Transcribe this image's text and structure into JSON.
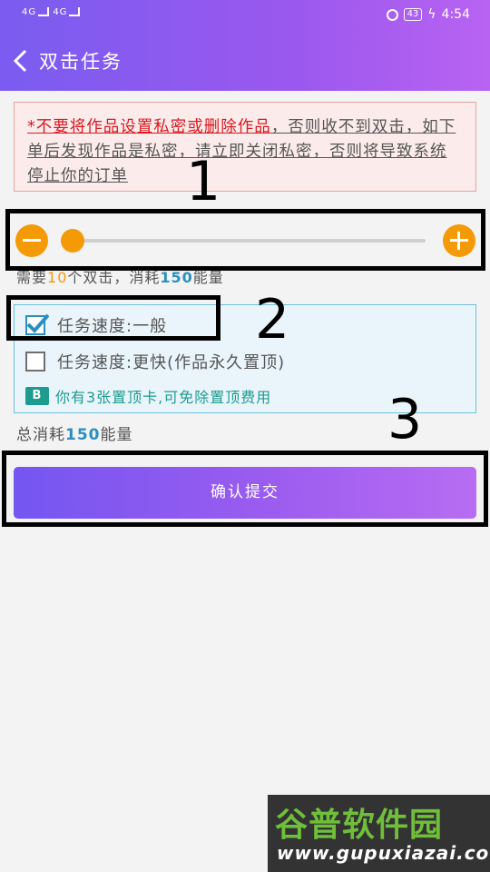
{
  "status_bar": {
    "network_left": "4G",
    "network_right": "4G",
    "battery": "43",
    "time": "4:54"
  },
  "header": {
    "title": "双击任务"
  },
  "notice": {
    "asterisk_text": "*不要将作品设置私密或删除作品",
    "rest_text": "，否则收不到双击，如下单后发现作品是私密，请立即关闭私密，否则将导致系统停止你的订单"
  },
  "slider": {
    "value_fraction": 0.01
  },
  "need": {
    "prefix": "需要",
    "count": "10",
    "middle": "个双击，消耗",
    "energy": "150",
    "suffix": "能量"
  },
  "options": {
    "normal": {
      "label": "任务速度:一般",
      "checked": true
    },
    "fast": {
      "label": "任务速度:更快(作品永久置顶)",
      "checked": false
    },
    "card": {
      "icon": "ticket-icon",
      "text": "你有3张置顶卡,可免除置顶费用"
    }
  },
  "total": {
    "prefix": "总消耗",
    "energy": "150",
    "suffix": "能量"
  },
  "submit": {
    "label": "确认提交"
  },
  "annotations": {
    "one": "1",
    "two": "2",
    "three": "3"
  },
  "watermark": {
    "top": "谷普软件园",
    "bottom": "www.gupuxiazai.com"
  },
  "colors": {
    "primary": "#8a5bf0",
    "accent": "#f59a07",
    "link": "#2a8fbf",
    "warning": "#d7181f"
  }
}
